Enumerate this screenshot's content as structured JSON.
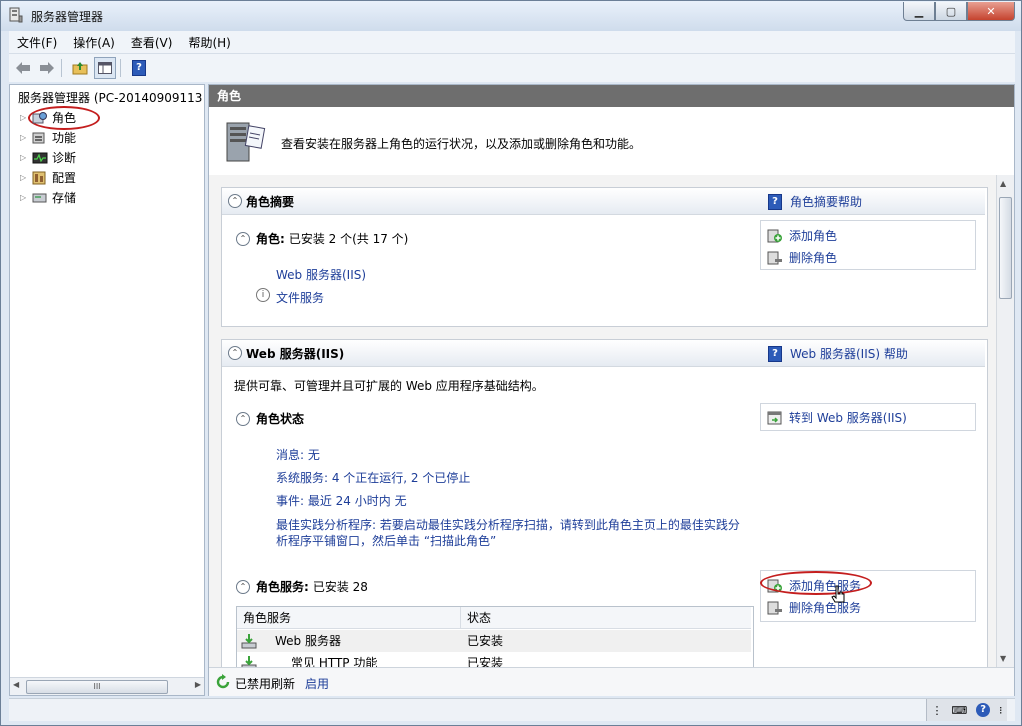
{
  "window": {
    "title": "服务器管理器",
    "controls": [
      "minimize",
      "maximize",
      "close"
    ]
  },
  "menu": [
    "文件(F)",
    "操作(A)",
    "查看(V)",
    "帮助(H)"
  ],
  "tree": {
    "root": "服务器管理器 (PC-20140909113",
    "items": [
      "角色",
      "功能",
      "诊断",
      "配置",
      "存储"
    ]
  },
  "pane": {
    "header": "角色",
    "intro": "查看安装在服务器上角色的运行状况，以及添加或删除角色和功能。",
    "summary": {
      "title": "角色摘要",
      "help": "角色摘要帮助",
      "roles_label": "角色:",
      "roles_value": "已安装 2 个(共 17 个)",
      "role_items": [
        "Web 服务器(IIS)",
        "文件服务"
      ],
      "actions": [
        "添加角色",
        "删除角色"
      ]
    },
    "iis": {
      "title": "Web 服务器(IIS)",
      "help": "Web 服务器(IIS) 帮助",
      "desc": "提供可靠、可管理并且可扩展的 Web 应用程序基础结构。",
      "status_label": "角色状态",
      "goto": "转到 Web 服务器(IIS)",
      "status_lines": [
        "消息: 无",
        "系统服务: 4 个正在运行, 2 个已停止",
        "事件: 最近 24 小时内 无",
        "最佳实践分析程序: 若要启动最佳实践分析程序扫描，请转到此角色主页上的最佳实践分",
        "析程序平铺窗口，然后单击 “扫描此角色”"
      ],
      "services_label": "角色服务:",
      "services_value": "已安装 28",
      "service_actions": [
        "添加角色服务",
        "删除角色服务"
      ],
      "table": {
        "headers": [
          "角色服务",
          "状态"
        ],
        "rows": [
          {
            "name": "Web 服务器",
            "status": "已安装"
          },
          {
            "name": "常见 HTTP 功能",
            "status": "已安装"
          }
        ]
      }
    },
    "bottom": {
      "refresh_text": "已禁用刷新",
      "enable_link": "启用"
    }
  },
  "colors": {
    "accent_link": "#1e3e99",
    "header_bg": "#6e6e6e",
    "highlight_ring": "#c41e1e"
  }
}
